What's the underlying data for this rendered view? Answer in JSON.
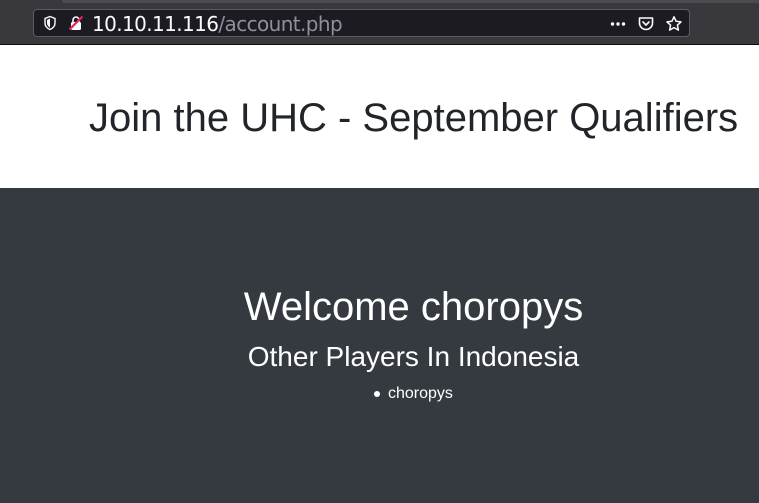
{
  "browser": {
    "url_host": "10.10.11.116",
    "url_path": "/account.php",
    "icons": [
      "shield-icon",
      "insecure-lock-icon",
      "more-actions-icon",
      "pocket-icon",
      "bookmark-star-icon"
    ]
  },
  "header": {
    "title": "Join the UHC - September Qualifiers"
  },
  "main": {
    "welcome": "Welcome choropys",
    "subheading": "Other Players In Indonesia",
    "players": [
      "choropys"
    ]
  },
  "colors": {
    "dark_background": "#343a40",
    "heading_text": "#212529",
    "white": "#ffffff"
  }
}
